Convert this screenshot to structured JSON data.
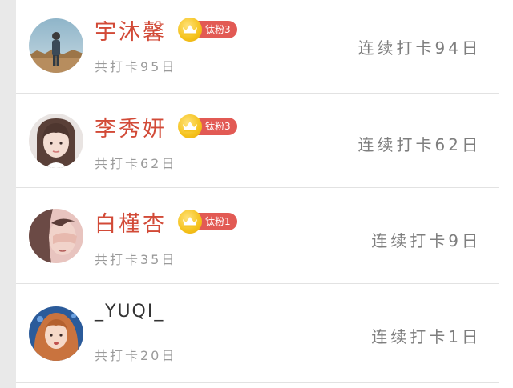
{
  "users": [
    {
      "name": "宇沐馨",
      "badge": "钛粉3",
      "total_label": "共打卡95日",
      "streak_label": "连续打卡94日",
      "avatar_icon": "avatar-photo-person-field",
      "name_color": "#d24a37"
    },
    {
      "name": "李秀妍",
      "badge": "钛粉3",
      "total_label": "共打卡62日",
      "streak_label": "连续打卡62日",
      "avatar_icon": "avatar-photo-girl-bangs",
      "name_color": "#d24a37"
    },
    {
      "name": "白槿杏",
      "badge": "钛粉1",
      "total_label": "共打卡35日",
      "streak_label": "连续打卡9日",
      "avatar_icon": "avatar-photo-girl-covering-face",
      "name_color": "#d24a37"
    },
    {
      "name": "_YUQI_",
      "badge": "",
      "total_label": "共打卡20日",
      "streak_label": "连续打卡1日",
      "avatar_icon": "avatar-photo-girl-curly-hair",
      "name_color": "#333333"
    }
  ],
  "colors": {
    "badge_bg": "#e25a54",
    "crown": "#f5c21b",
    "secondary_text": "#9a9a9a",
    "streak_text": "#7e7e7e"
  }
}
